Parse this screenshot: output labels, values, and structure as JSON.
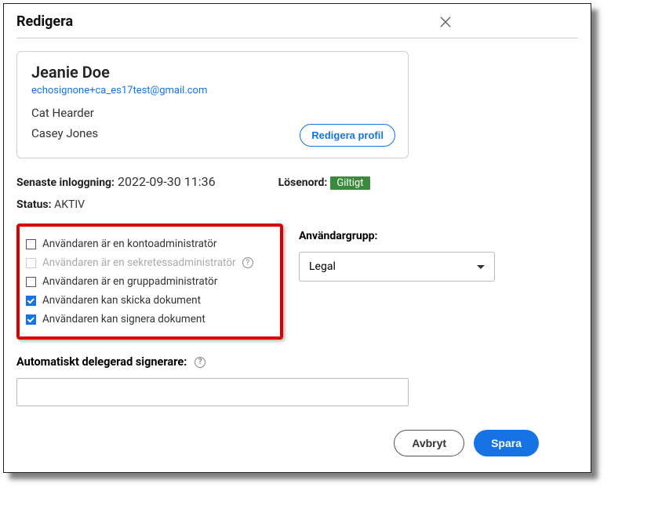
{
  "dialog": {
    "title": "Redigera"
  },
  "profile": {
    "name": "Jeanie Doe",
    "email": "echosignone+ca_es17test@gmail.com",
    "title": "Cat Hearder",
    "company": "Casey Jones",
    "edit_button": "Redigera profil"
  },
  "info": {
    "last_login_label": "Senaste inloggning:",
    "last_login_value": "2022-09-30 11:36",
    "password_label": "Lösenord:",
    "password_value": "Giltigt",
    "status_label": "Status:",
    "status_value": "AKTIV"
  },
  "permissions": {
    "account_admin": "Användaren är en kontoadministratör",
    "privacy_admin": "Användaren är en sekretessadministratör",
    "group_admin": "Användaren är en gruppadministratör",
    "can_send": "Användaren kan skicka dokument",
    "can_sign": "Användaren kan signera dokument"
  },
  "group": {
    "label": "Användargrupp:",
    "value": "Legal"
  },
  "delegate": {
    "label": "Automatiskt delegerad signerare:",
    "value": ""
  },
  "footer": {
    "cancel": "Avbryt",
    "save": "Spara"
  }
}
